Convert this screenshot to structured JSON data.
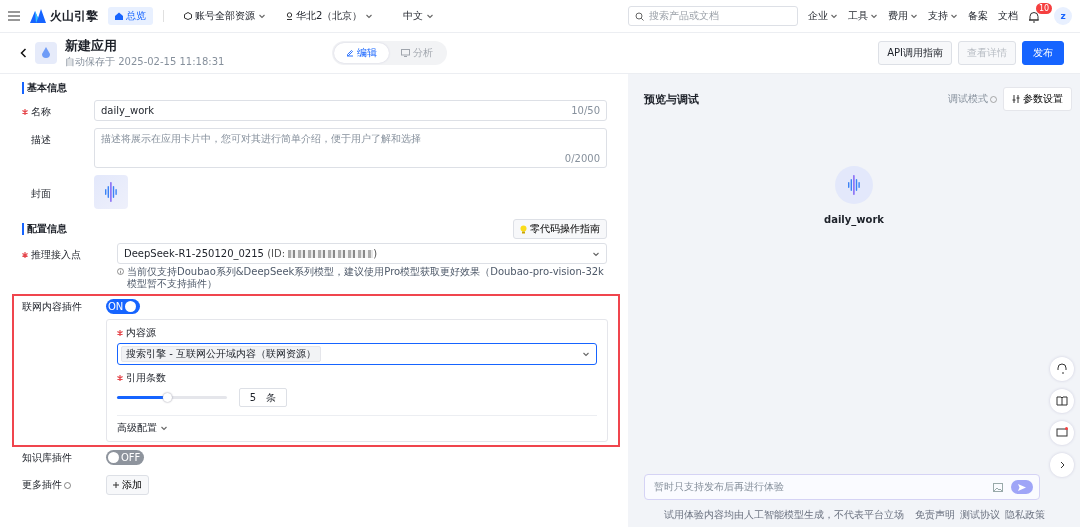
{
  "topbar": {
    "brand": "火山引擎",
    "home_tab": "总览",
    "scope": "账号全部资源",
    "region": "华北2（北京）",
    "language": "中文",
    "search": {
      "placeholder": "搜索产品或文档"
    },
    "menus": [
      {
        "label": "企业",
        "dropdown": true
      },
      {
        "label": "工具",
        "dropdown": true
      },
      {
        "label": "费用",
        "dropdown": true
      },
      {
        "label": "支持",
        "dropdown": true
      },
      {
        "label": "备案",
        "dropdown": false
      },
      {
        "label": "文档",
        "dropdown": false
      }
    ],
    "notifications": "10",
    "avatar": "z"
  },
  "header": {
    "title": "新建应用",
    "autosave": "自动保存于 2025-02-15 11:18:31",
    "modes": [
      {
        "label": "编辑",
        "selected": true
      },
      {
        "label": "分析",
        "selected": false
      }
    ],
    "buttons": [
      {
        "label": "API调用指南",
        "kind": "default"
      },
      {
        "label": "查看详情",
        "kind": "disabled"
      },
      {
        "label": "发布",
        "kind": "primary"
      }
    ]
  },
  "basic": {
    "title": "基本信息",
    "name": {
      "label": "名称",
      "required": true,
      "value": "daily_work",
      "count": "10/50"
    },
    "description": {
      "label": "描述",
      "placeholder": "描述将展示在应用卡片中，您可对其进行简单介绍，便于用户了解和选择",
      "count": "0/2000"
    },
    "cover": {
      "label": "封面"
    }
  },
  "config": {
    "title": "配置信息",
    "guide_button": "零代码操作指南",
    "endpoint": {
      "label": "推理接入点",
      "required": true,
      "value": "DeepSeek-R1-250120_0215",
      "id_prefix": "(ID: ",
      "id_suffix": ")",
      "hint": "当前仅支持Doubao系列&DeepSeek系列模型，建议使用Pro模型获取更好效果（Doubao-pro-vision-32k模型暂不支持插件）"
    },
    "plugins": [
      {
        "label": "联网内容插件",
        "on": true,
        "state_label": "ON",
        "highlighted": true,
        "settings": {
          "source_label": "内容源",
          "source_value": "搜索引擎 - 互联网公开域内容（联网资源）",
          "count_label": "引用条数",
          "level": 0.45,
          "count_value": "5",
          "count_unit": "条",
          "advanced": "高级配置"
        }
      },
      {
        "label": "知识库插件",
        "on": false,
        "state_label": "OFF",
        "highlighted": false
      }
    ],
    "more_plugins": {
      "label": "更多插件",
      "add_button": "添加"
    }
  },
  "preview": {
    "title": "预览与调试",
    "debug_mode": "调试模式",
    "settings_button": "参数设置",
    "app_name": "daily_work",
    "chat": {
      "placeholder": "暂时只支持发布后再进行体验"
    },
    "footer": {
      "note": "试用体验内容均由人工智能模型生成，不代表平台立场",
      "links": [
        "免责声明",
        "测试协议",
        "隐私政策"
      ]
    },
    "unread_feedback": true
  }
}
